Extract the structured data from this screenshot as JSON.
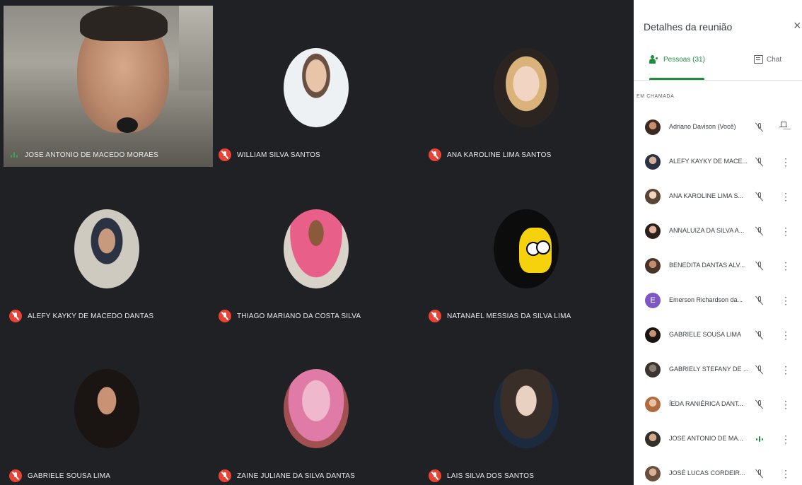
{
  "tiles": [
    {
      "name": "JOSE ANTONIO DE MACEDO MORAES",
      "speaking": true,
      "video": true
    },
    {
      "name": "WILLIAM SILVA SANTOS",
      "muted": true
    },
    {
      "name": "ANA KAROLINE LIMA SANTOS",
      "muted": true
    },
    {
      "name": "ALEFY KAYKY DE MACEDO DANTAS",
      "muted": true
    },
    {
      "name": "THIAGO MARIANO DA COSTA SILVA",
      "muted": true
    },
    {
      "name": "NATANAEL MESSIAS DA SILVA LIMA",
      "muted": true
    },
    {
      "name": "GABRIELE SOUSA LIMA",
      "muted": true
    },
    {
      "name": "ZAINE JULIANE DA SILVA DANTAS",
      "muted": true
    },
    {
      "name": "LAIS SILVA DOS SANTOS",
      "muted": true
    }
  ],
  "panel": {
    "title": "Detalhes da reunião",
    "close_icon": "×",
    "tabs": {
      "people": "Pessoas (31)",
      "chat": "Chat"
    },
    "section": "EM CHAMADA",
    "people": [
      {
        "name": "Adriano Davison (Você)",
        "icon": "mic-off",
        "action": "pin"
      },
      {
        "name": "ALEFY KAYKY DE MACE...",
        "icon": "mic-off",
        "action": "more"
      },
      {
        "name": "ANA KAROLINE LIMA S...",
        "icon": "mic-off",
        "action": "more"
      },
      {
        "name": "ANNALUIZA DA SILVA A...",
        "icon": "mic-off",
        "action": "more"
      },
      {
        "name": "BENEDITA DANTAS ALV...",
        "icon": "mic-off",
        "action": "more"
      },
      {
        "name": "Emerson Richardson da...",
        "icon": "mic-off",
        "action": "more",
        "letter": "E"
      },
      {
        "name": "GABRIELE SOUSA LIMA",
        "icon": "mic-off",
        "action": "more"
      },
      {
        "name": "GABRIELY STEFANY DE ...",
        "icon": "mic-off",
        "action": "more"
      },
      {
        "name": "ÍEDA RANIÉRICA DANT...",
        "icon": "mic-off",
        "action": "more"
      },
      {
        "name": "JOSE ANTONIO DE MA...",
        "icon": "speaking",
        "action": "more"
      },
      {
        "name": "JOSÉ LUCAS CORDEIR...",
        "icon": "mic-off",
        "action": "more"
      }
    ]
  },
  "colors": {
    "stage": "#202124",
    "mute_red": "#ea4335",
    "accent_green": "#1e8e3e"
  }
}
